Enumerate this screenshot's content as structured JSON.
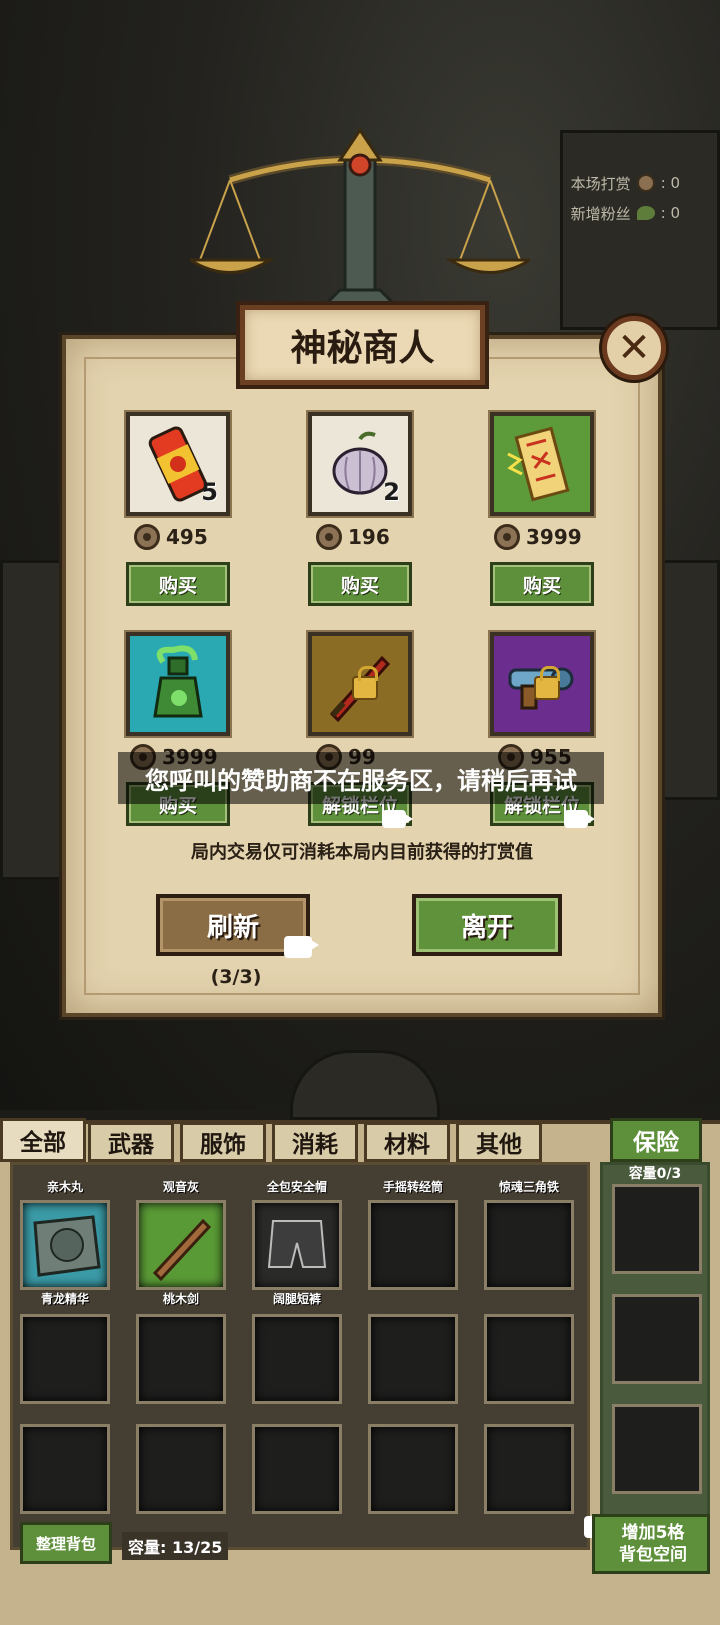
{
  "hud": {
    "tips_label": "本场打赏",
    "tips_value": ": 0",
    "fans_label": "新增粉丝",
    "fans_value": ": 0"
  },
  "shop": {
    "title": "神秘商人",
    "items": [
      {
        "name": "energy-drink",
        "quantity": "5",
        "price": "495",
        "button": "购买",
        "style": "white"
      },
      {
        "name": "garlic",
        "quantity": "2",
        "price": "196",
        "button": "购买",
        "style": "white"
      },
      {
        "name": "talisman",
        "quantity": "",
        "price": "3999",
        "button": "购买",
        "style": "green"
      },
      {
        "name": "poison-bottle",
        "quantity": "",
        "price": "3999",
        "button": "购买",
        "style": "teal"
      },
      {
        "name": "locked-sword",
        "quantity": "",
        "price": "99",
        "button": "解锁栏位",
        "style": "gold"
      },
      {
        "name": "locked-gun",
        "quantity": "",
        "price": "955",
        "button": "解锁栏位",
        "style": "purple"
      }
    ],
    "toast": "您呼叫的赞助商不在服务区，请稍后再试",
    "notice": "局内交易仅可消耗本局内目前获得的打赏值",
    "refresh_label": "刷新",
    "refresh_count": "(3/3)",
    "leave_label": "离开"
  },
  "inventory": {
    "tabs": [
      "全部",
      "武器",
      "服饰",
      "消耗",
      "材料",
      "其他"
    ],
    "insurance_tab": "保险",
    "insurance_capacity": "容量0/3",
    "top_row_labels": [
      "亲木丸",
      "观音灰",
      "全包安全帽",
      "手摇转经筒",
      "惊魂三角铁"
    ],
    "items": [
      {
        "label": "青龙精华",
        "style": "teal"
      },
      {
        "label": "桃木剑",
        "style": "green"
      },
      {
        "label": "阔腿短裤",
        "style": "grey"
      }
    ],
    "sort_label": "整理背包",
    "capacity_label": "容量: 13/25",
    "expand_label_line1": "增加5格",
    "expand_label_line2": "背包空间"
  }
}
